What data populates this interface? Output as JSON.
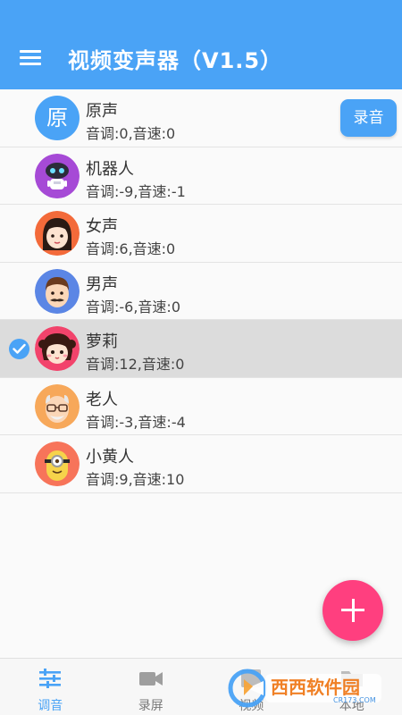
{
  "app": {
    "title": "视频变声器（V1.5）"
  },
  "header": {
    "menu_icon": "menu-icon"
  },
  "record_button": {
    "label": "录音"
  },
  "voices": [
    {
      "name": "原声",
      "params": "音调:0,音速:0",
      "avatar_char": "原",
      "avatar_color": "#4aa3f6",
      "avatar_icon": "original-avatar-icon"
    },
    {
      "name": "机器人",
      "params": "音调:-9,音速:-1",
      "avatar_color": "#a64ad6",
      "avatar_icon": "robot-avatar-icon"
    },
    {
      "name": "女声",
      "params": "音调:6,音速:0",
      "avatar_color": "#f36a3a",
      "avatar_icon": "female-avatar-icon"
    },
    {
      "name": "男声",
      "params": "音调:-6,音速:0",
      "avatar_color": "#5b86e5",
      "avatar_icon": "male-avatar-icon"
    },
    {
      "name": "萝莉",
      "params": "音调:12,音速:0",
      "avatar_color": "#f2436b",
      "avatar_icon": "loli-avatar-icon",
      "selected": true
    },
    {
      "name": "老人",
      "params": "音调:-3,音速:-4",
      "avatar_color": "#f7a85a",
      "avatar_icon": "elder-avatar-icon"
    },
    {
      "name": "小黄人",
      "params": "音调:9,音速:10",
      "avatar_color": "#f7745a",
      "avatar_icon": "minion-avatar-icon"
    }
  ],
  "fab": {
    "icon": "plus-icon"
  },
  "bottom_nav": [
    {
      "label": "调音",
      "icon": "tune-icon",
      "active": true
    },
    {
      "label": "录屏",
      "icon": "video-camera-icon"
    },
    {
      "label": "视频",
      "icon": "video-file-icon"
    },
    {
      "label": "本地",
      "icon": "folder-icon"
    }
  ],
  "watermark": {
    "text": "西西软件园",
    "subtext": "CR173.COM"
  },
  "colors": {
    "primary": "#4aa3f6",
    "accent": "#ff3f7f",
    "selected_row": "#dcdcdc"
  }
}
